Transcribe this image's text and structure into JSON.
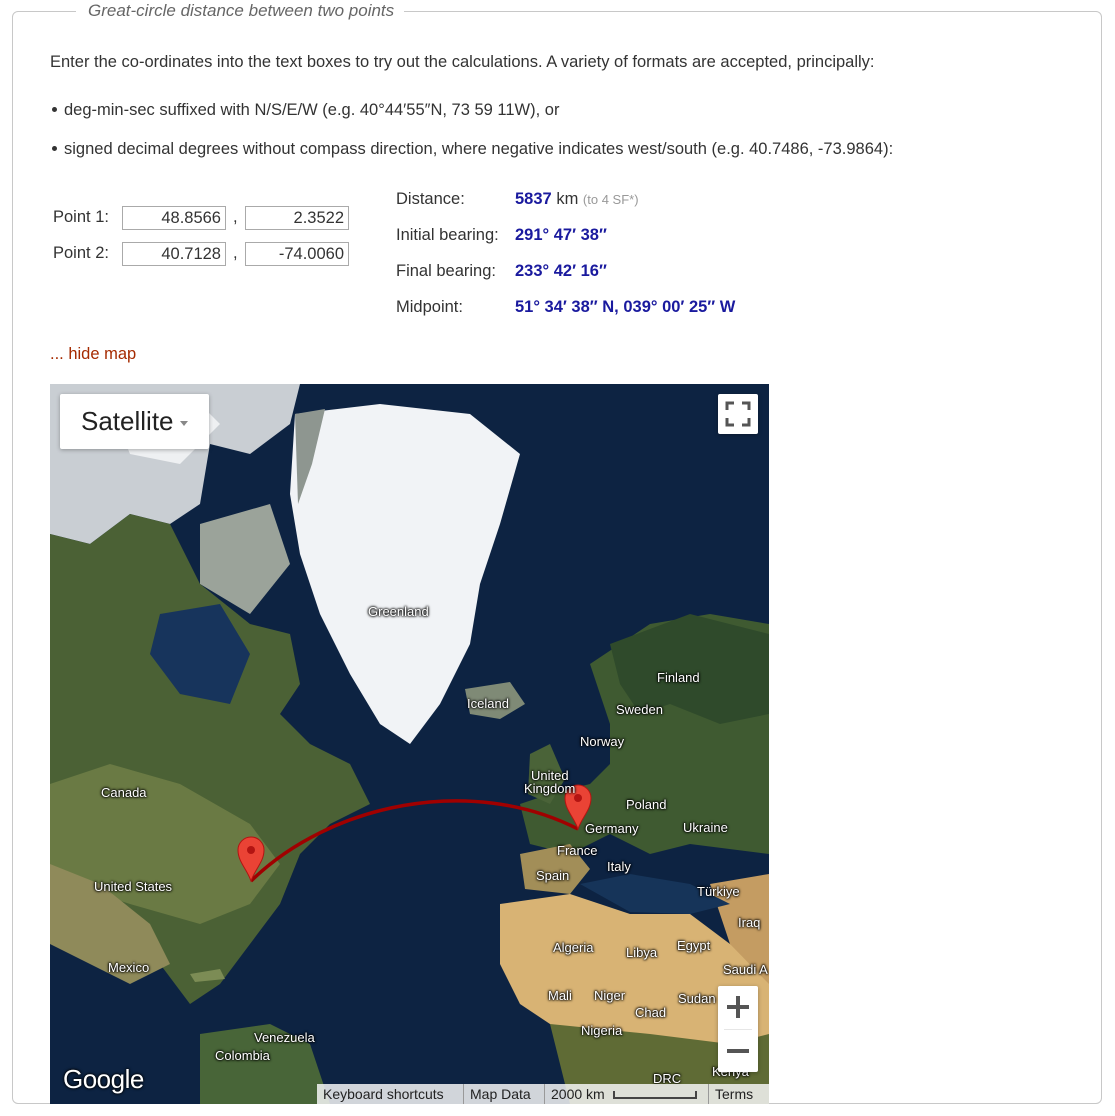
{
  "legend": "Great-circle distance between two points",
  "intro": "Enter the co-ordinates into the text boxes to try out the calculations. A variety of formats are accepted, principally:",
  "bullets": [
    "deg-min-sec suffixed with N/S/E/W (e.g. 40°44′55″N, 73 59 11W), or",
    "signed decimal degrees without compass direction, where negative indicates west/south (e.g. 40.7486, -73.9864):"
  ],
  "points": {
    "p1": {
      "label": "Point 1:",
      "lat": "48.8566",
      "lon": "2.3522"
    },
    "p2": {
      "label": "Point 2:",
      "lat": "40.7128",
      "lon": "-74.0060"
    },
    "comma": ","
  },
  "results": {
    "distance_label": "Distance:",
    "distance_value": "5837",
    "distance_unit": "km",
    "distance_note": "(to 4 SF*)",
    "initial_label": "Initial bearing:",
    "initial_value": "291° 47′ 38″",
    "final_label": "Final bearing:",
    "final_value": "233° 42′ 16″",
    "midpoint_label": "Midpoint:",
    "midpoint_value": "51° 34′ 38″ N, 039° 00′ 25″ W"
  },
  "hide_map": "... hide map",
  "map": {
    "type_label": "Satellite",
    "google": "Google",
    "attribution": {
      "shortcuts": "Keyboard shortcuts",
      "map_data": "Map Data",
      "scale": "2000 km",
      "terms": "Terms"
    },
    "labels": {
      "greenland": "Greenland",
      "iceland": "Iceland",
      "finland": "Finland",
      "sweden": "Sweden",
      "norway": "Norway",
      "united_kingdom_1": "United",
      "united_kingdom_2": "Kingdom",
      "poland": "Poland",
      "germany": "Germany",
      "ukraine": "Ukraine",
      "france": "France",
      "italy": "Italy",
      "spain": "Spain",
      "turkiye": "Türkiye",
      "iraq": "Iraq",
      "canada": "Canada",
      "united_states": "United States",
      "mexico": "Mexico",
      "algeria": "Algeria",
      "libya": "Libya",
      "egypt": "Egypt",
      "saudi": "Saudi A",
      "mali": "Mali",
      "niger": "Niger",
      "sudan": "Sudan",
      "chad": "Chad",
      "nigeria": "Nigeria",
      "venezuela": "Venezuela",
      "colombia": "Colombia",
      "drc": "DRC",
      "kenya": "Kenya"
    },
    "colors": {
      "ocean": "#0d2342",
      "ice": "#f1f3f6",
      "land": "#3e5a33",
      "desert": "#d8b374",
      "route": "#a00000",
      "marker": "#ea4335"
    }
  }
}
